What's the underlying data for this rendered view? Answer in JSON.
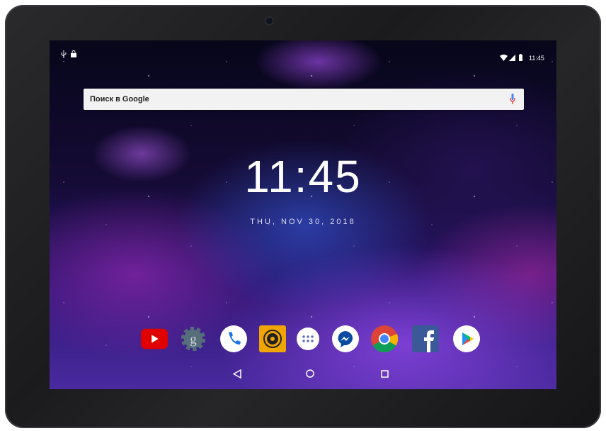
{
  "status_bar": {
    "time": "11:45",
    "left_icons": [
      "usb-icon",
      "lock-icon"
    ],
    "right_icons": [
      "wifi-icon",
      "signal-icon",
      "battery-icon"
    ]
  },
  "search": {
    "placeholder": "Поиск в Google"
  },
  "clock": {
    "time": "11:45",
    "date": "THU, NOV 30, 2018"
  },
  "dock": [
    {
      "name": "YouTube",
      "icon": "youtube-icon",
      "color": "#e00000"
    },
    {
      "name": "Google Settings",
      "icon": "google-settings-icon",
      "color": "#546e7a"
    },
    {
      "name": "Phone",
      "icon": "phone-icon",
      "color": "#1a73e8"
    },
    {
      "name": "Camera",
      "icon": "camera-icon",
      "color": "#f0a500"
    },
    {
      "name": "Apps",
      "icon": "app-drawer-icon",
      "color": "#ffffff"
    },
    {
      "name": "Messenger",
      "icon": "messenger-icon",
      "color": "#0a4aa0"
    },
    {
      "name": "Chrome",
      "icon": "chrome-icon",
      "color": "#db4437"
    },
    {
      "name": "Facebook",
      "icon": "facebook-icon",
      "color": "#3b5998"
    },
    {
      "name": "Play Store",
      "icon": "play-store-icon",
      "color": "#00c853"
    }
  ],
  "nav": [
    "back",
    "home",
    "recents"
  ]
}
